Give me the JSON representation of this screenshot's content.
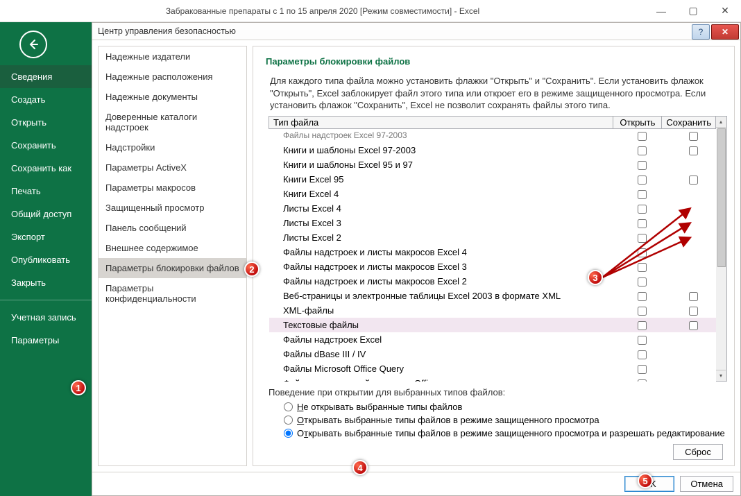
{
  "app_title": "Забракованные препараты с 1 по 15 апреля 2020  [Режим совместимости] - Excel",
  "sidebar": {
    "items": [
      {
        "label": "Сведения",
        "selected": true
      },
      {
        "label": "Создать"
      },
      {
        "label": "Открыть"
      },
      {
        "label": "Сохранить"
      },
      {
        "label": "Сохранить как"
      },
      {
        "label": "Печать"
      },
      {
        "label": "Общий доступ"
      },
      {
        "label": "Экспорт"
      },
      {
        "label": "Опубликовать"
      },
      {
        "label": "Закрыть"
      }
    ],
    "bottom": [
      {
        "label": "Учетная запись"
      },
      {
        "label": "Параметры"
      }
    ]
  },
  "dialog": {
    "title": "Центр управления безопасностью",
    "categories": [
      "Надежные издатели",
      "Надежные расположения",
      "Надежные документы",
      "Доверенные каталоги надстроек",
      "Надстройки",
      "Параметры ActiveX",
      "Параметры макросов",
      "Защищенный просмотр",
      "Панель сообщений",
      "Внешнее содержимое",
      "Параметры блокировки файлов",
      "Параметры конфиденциальности"
    ],
    "selected_category": 10,
    "section_title": "Параметры блокировки файлов",
    "section_desc": "Для каждого типа файла можно установить флажки \"Открыть\" и \"Сохранить\". Если установить флажок \"Открыть\", Excel заблокирует файл этого типа или откроет его в режиме защищенного просмотра. Если установить флажок \"Сохранить\", Excel не позволит сохранять файлы этого типа.",
    "columns": {
      "type": "Тип файла",
      "open": "Открыть",
      "save": "Сохранить"
    },
    "rows": [
      {
        "name": "Файлы надстроек Excel 97-2003",
        "open_cb": true,
        "save_cb": true
      },
      {
        "name": "Книги и шаблоны Excel 97-2003",
        "open_cb": true,
        "save_cb": true
      },
      {
        "name": "Книги и шаблоны Excel 95 и 97",
        "open_cb": true,
        "save_cb": false
      },
      {
        "name": "Книги Excel 95",
        "open_cb": true,
        "save_cb": true
      },
      {
        "name": "Книги Excel 4",
        "open_cb": true,
        "save_cb": false
      },
      {
        "name": "Листы Excel 4",
        "open_cb": true,
        "save_cb": false
      },
      {
        "name": "Листы Excel 3",
        "open_cb": true,
        "save_cb": false
      },
      {
        "name": "Листы Excel 2",
        "open_cb": true,
        "save_cb": false
      },
      {
        "name": "Файлы надстроек и листы макросов Excel 4",
        "open_cb": true,
        "save_cb": false
      },
      {
        "name": "Файлы надстроек и листы макросов Excel 3",
        "open_cb": true,
        "save_cb": false
      },
      {
        "name": "Файлы надстроек и листы макросов Excel 2",
        "open_cb": true,
        "save_cb": false
      },
      {
        "name": "Веб-страницы и электронные таблицы Excel 2003 в формате XML",
        "open_cb": true,
        "save_cb": true
      },
      {
        "name": "XML-файлы",
        "open_cb": true,
        "save_cb": true
      },
      {
        "name": "Текстовые файлы",
        "open_cb": true,
        "save_cb": true,
        "selected": true,
        "save_shaded": true
      },
      {
        "name": "Файлы надстроек Excel",
        "open_cb": true,
        "save_cb": false
      },
      {
        "name": "Файлы dBase III / IV",
        "open_cb": true,
        "save_cb": false
      },
      {
        "name": "Файлы Microsoft Office Query",
        "open_cb": true,
        "save_cb": false
      },
      {
        "name": "Файлы подключений к данным Office",
        "open_cb": true,
        "save_cb": false
      }
    ],
    "behavior_label": "Поведение при открытии для выбранных типов файлов:",
    "radios": [
      {
        "label": "Не открывать выбранные типы файлов"
      },
      {
        "label": "Открывать выбранные типы файлов в режиме защищенного просмотра"
      },
      {
        "label": "Открывать выбранные типы файлов в режиме защищенного просмотра и разрешать редактирование",
        "checked": true
      }
    ],
    "reset": "Сброс",
    "ok": "OK",
    "cancel": "Отмена"
  },
  "callouts": {
    "1": "1",
    "2": "2",
    "3": "3",
    "4": "4",
    "5": "5"
  }
}
